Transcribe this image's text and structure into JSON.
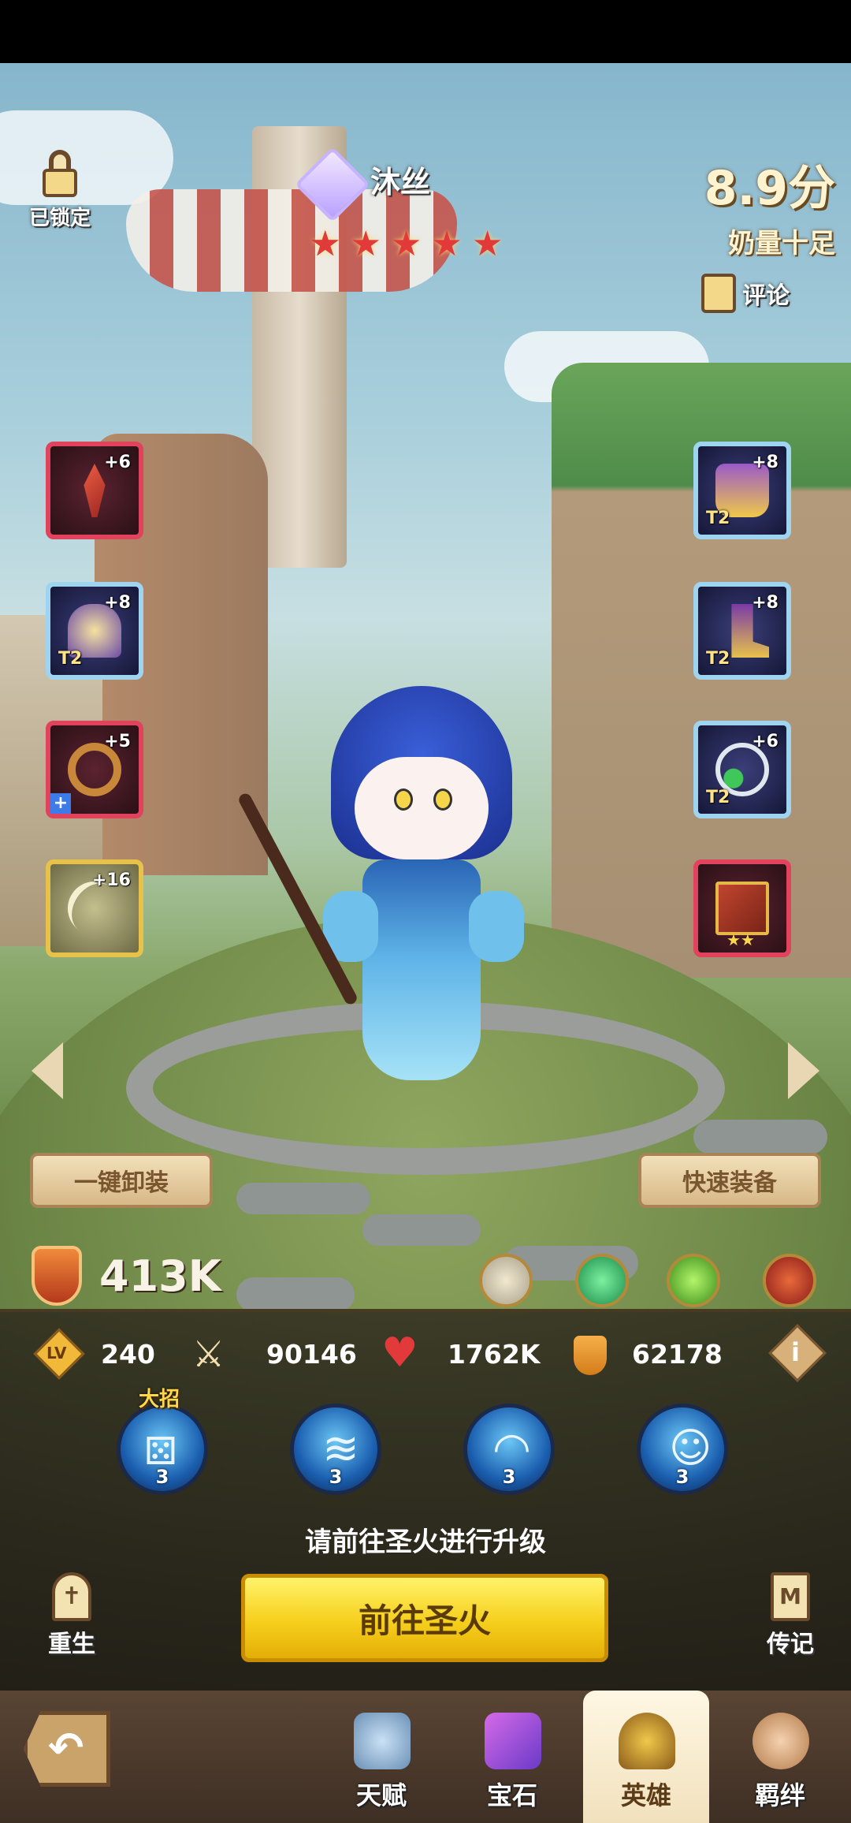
{
  "hero": {
    "name": "沐丝",
    "stars": 5,
    "rating_score": "8.9分",
    "rating_tag": "奶量十足",
    "comment_label": "评论",
    "lock_label": "已锁定",
    "power": "413K"
  },
  "equipment_left": [
    {
      "plus": "+6",
      "tier": "",
      "style": "red",
      "icon": "staff-icon"
    },
    {
      "plus": "+8",
      "tier": "T2",
      "style": "blue",
      "icon": "helmet-icon"
    },
    {
      "plus": "+5",
      "tier": "",
      "style": "red",
      "icon": "ring-icon"
    },
    {
      "plus": "+16",
      "tier": "",
      "style": "gold",
      "icon": "bow-icon"
    }
  ],
  "equipment_right": [
    {
      "plus": "+8",
      "tier": "T2",
      "style": "blue",
      "icon": "armor-icon"
    },
    {
      "plus": "+8",
      "tier": "T2",
      "style": "blue",
      "icon": "boots-icon"
    },
    {
      "plus": "+6",
      "tier": "T2",
      "style": "blue",
      "icon": "necklace-icon"
    },
    {
      "plus": "",
      "tier": "",
      "style": "red",
      "icon": "book-icon"
    }
  ],
  "buttons": {
    "unequip_all": "一键卸装",
    "quick_equip": "快速装备",
    "go_sacred_fire": "前往圣火",
    "rebirth": "重生",
    "biography": "传记"
  },
  "stats": {
    "level": "240",
    "level_badge": "LV",
    "attack": "90146",
    "hp": "1762K",
    "defense": "62178"
  },
  "skills": [
    {
      "level": "3",
      "tag": "大招",
      "icon": "dice-skill-icon"
    },
    {
      "level": "3",
      "tag": "",
      "icon": "flame-skill-icon"
    },
    {
      "level": "3",
      "tag": "",
      "icon": "wave-skill-icon"
    },
    {
      "level": "3",
      "tag": "",
      "icon": "spirit-skill-icon"
    }
  ],
  "upgrade_hint": "请前往圣火进行升级",
  "nav": {
    "talent": "天赋",
    "gem": "宝石",
    "hero": "英雄",
    "bond": "羁绊"
  },
  "colors": {
    "accent_yellow": "#f6cf1c",
    "slot_red": "#e0435b",
    "slot_blue": "#9fd4f0",
    "slot_gold": "#e6c24b"
  }
}
